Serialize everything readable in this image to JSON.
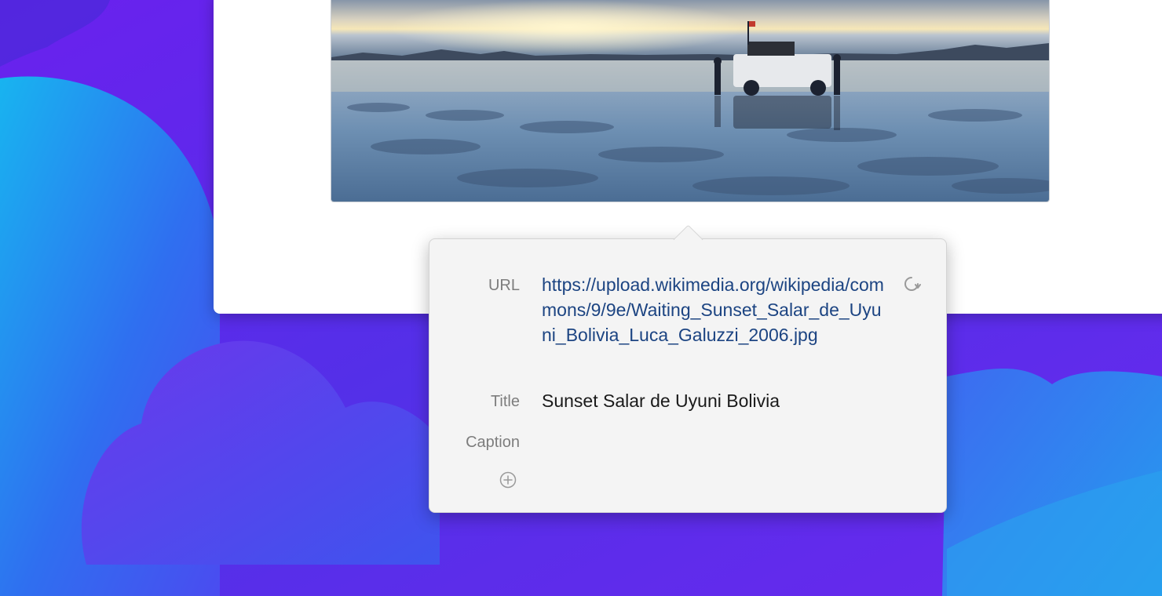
{
  "popover": {
    "url_label": "URL",
    "url_value": "https://upload.wikimedia.org/wikipedia/commons/9/9e/Waiting_Sunset_Salar_de_Uyuni_Bolivia_Luca_Galuzzi_2006.jpg",
    "title_label": "Title",
    "title_value": "Sunset Salar de Uyuni Bolivia",
    "caption_label": "Caption",
    "caption_value": "",
    "icons": {
      "reload": "reload-icon",
      "add": "add-field-icon"
    }
  },
  "colors": {
    "link": "#1c4482",
    "label": "#7d7d7d",
    "popover_bg": "#f4f4f4"
  }
}
